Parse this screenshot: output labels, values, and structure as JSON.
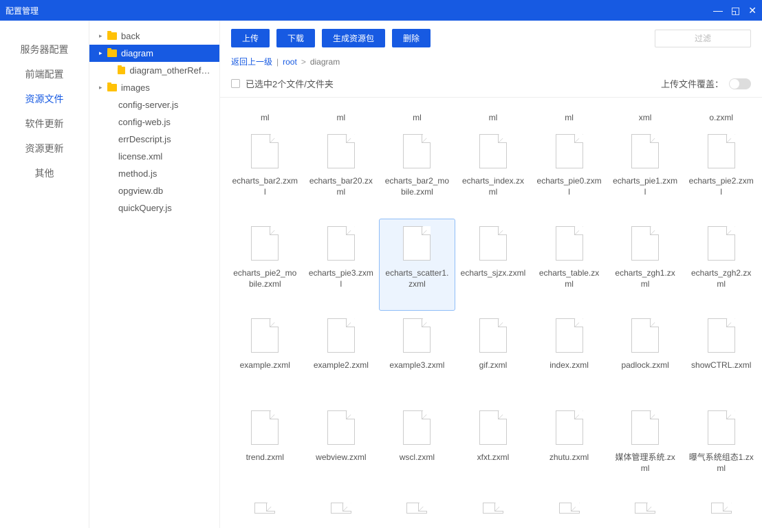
{
  "titlebar": {
    "title": "配置管理"
  },
  "sidebar": {
    "items": [
      {
        "label": "服务器配置",
        "active": false
      },
      {
        "label": "前端配置",
        "active": false
      },
      {
        "label": "资源文件",
        "active": true
      },
      {
        "label": "软件更新",
        "active": false
      },
      {
        "label": "资源更新",
        "active": false
      },
      {
        "label": "其他",
        "active": false
      }
    ]
  },
  "tree": {
    "nodes": [
      {
        "label": "back",
        "depth": 0,
        "folder": true,
        "expandable": true,
        "selected": false
      },
      {
        "label": "diagram",
        "depth": 0,
        "folder": true,
        "expandable": true,
        "selected": true
      },
      {
        "label": "diagram_otherReference",
        "depth": 1,
        "folder": true,
        "expandable": false,
        "selected": false
      },
      {
        "label": "images",
        "depth": 0,
        "folder": true,
        "expandable": true,
        "selected": false
      },
      {
        "label": "config-server.js",
        "depth": 1,
        "folder": false,
        "expandable": false,
        "selected": false
      },
      {
        "label": "config-web.js",
        "depth": 1,
        "folder": false,
        "expandable": false,
        "selected": false
      },
      {
        "label": "errDescript.js",
        "depth": 1,
        "folder": false,
        "expandable": false,
        "selected": false
      },
      {
        "label": "license.xml",
        "depth": 1,
        "folder": false,
        "expandable": false,
        "selected": false
      },
      {
        "label": "method.js",
        "depth": 1,
        "folder": false,
        "expandable": false,
        "selected": false
      },
      {
        "label": "opgview.db",
        "depth": 1,
        "folder": false,
        "expandable": false,
        "selected": false
      },
      {
        "label": "quickQuery.js",
        "depth": 1,
        "folder": false,
        "expandable": false,
        "selected": false
      }
    ]
  },
  "toolbar": {
    "upload": "上传",
    "download": "下载",
    "generate": "生成资源包",
    "delete": "删除",
    "filter_placeholder": "过滤"
  },
  "breadcrumb": {
    "back": "返回上一级",
    "root": "root",
    "current": "diagram"
  },
  "selection": {
    "text": "已选中2个文件/文件夹",
    "overwrite_label": "上传文件覆盖："
  },
  "partial_labels": [
    "ml",
    "ml",
    "ml",
    "ml",
    "ml",
    "xml",
    "o.zxml"
  ],
  "files": [
    {
      "name": "echarts_bar2.zxml",
      "selected": false
    },
    {
      "name": "echarts_bar20.zxml",
      "selected": false
    },
    {
      "name": "echarts_bar2_mobile.zxml",
      "selected": false
    },
    {
      "name": "echarts_index.zxml",
      "selected": false
    },
    {
      "name": "echarts_pie0.zxml",
      "selected": false
    },
    {
      "name": "echarts_pie1.zxml",
      "selected": false
    },
    {
      "name": "echarts_pie2.zxml",
      "selected": false
    },
    {
      "name": "echarts_pie2_mobile.zxml",
      "selected": false
    },
    {
      "name": "echarts_pie3.zxml",
      "selected": false
    },
    {
      "name": "echarts_scatter1.zxml",
      "selected": true
    },
    {
      "name": "echarts_sjzx.zxml",
      "selected": false
    },
    {
      "name": "echarts_table.zxml",
      "selected": false
    },
    {
      "name": "echarts_zgh1.zxml",
      "selected": false
    },
    {
      "name": "echarts_zgh2.zxml",
      "selected": false
    },
    {
      "name": "example.zxml",
      "selected": false
    },
    {
      "name": "example2.zxml",
      "selected": false
    },
    {
      "name": "example3.zxml",
      "selected": false
    },
    {
      "name": "gif.zxml",
      "selected": false
    },
    {
      "name": "index.zxml",
      "selected": false
    },
    {
      "name": "padlock.zxml",
      "selected": false
    },
    {
      "name": "showCTRL.zxml",
      "selected": false
    },
    {
      "name": "trend.zxml",
      "selected": false
    },
    {
      "name": "webview.zxml",
      "selected": false
    },
    {
      "name": "wscl.zxml",
      "selected": false
    },
    {
      "name": "xfxt.zxml",
      "selected": false
    },
    {
      "name": "zhutu.zxml",
      "selected": false
    },
    {
      "name": "媒体管理系统.zxml",
      "selected": false
    },
    {
      "name": "曝气系统组态1.zxml",
      "selected": false
    }
  ]
}
